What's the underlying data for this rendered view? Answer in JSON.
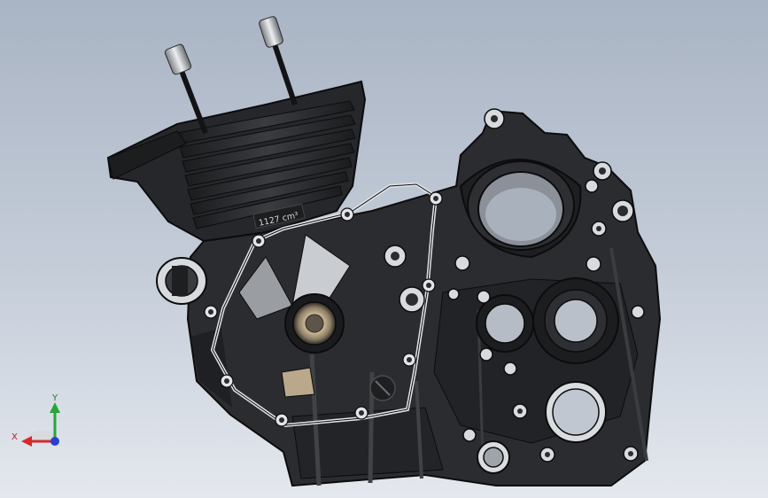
{
  "viewport": {
    "background_top": "#a9b4c4",
    "background_bottom": "#e4e8ee"
  },
  "model": {
    "cylinder_label": "1127 cm³",
    "colors": {
      "body": "#2b2c2f",
      "body_dark": "#1a1b1d",
      "edge": "#0c0c0d",
      "highlight": "#c9ccd0",
      "gasket": "#e2e4e7",
      "bearing": "#b9a98a"
    }
  },
  "triad": {
    "x_label": "X",
    "y_label": "Y",
    "colors": {
      "x": "#d8282a",
      "y": "#26a63a",
      "z": "#2a3fd8"
    }
  }
}
